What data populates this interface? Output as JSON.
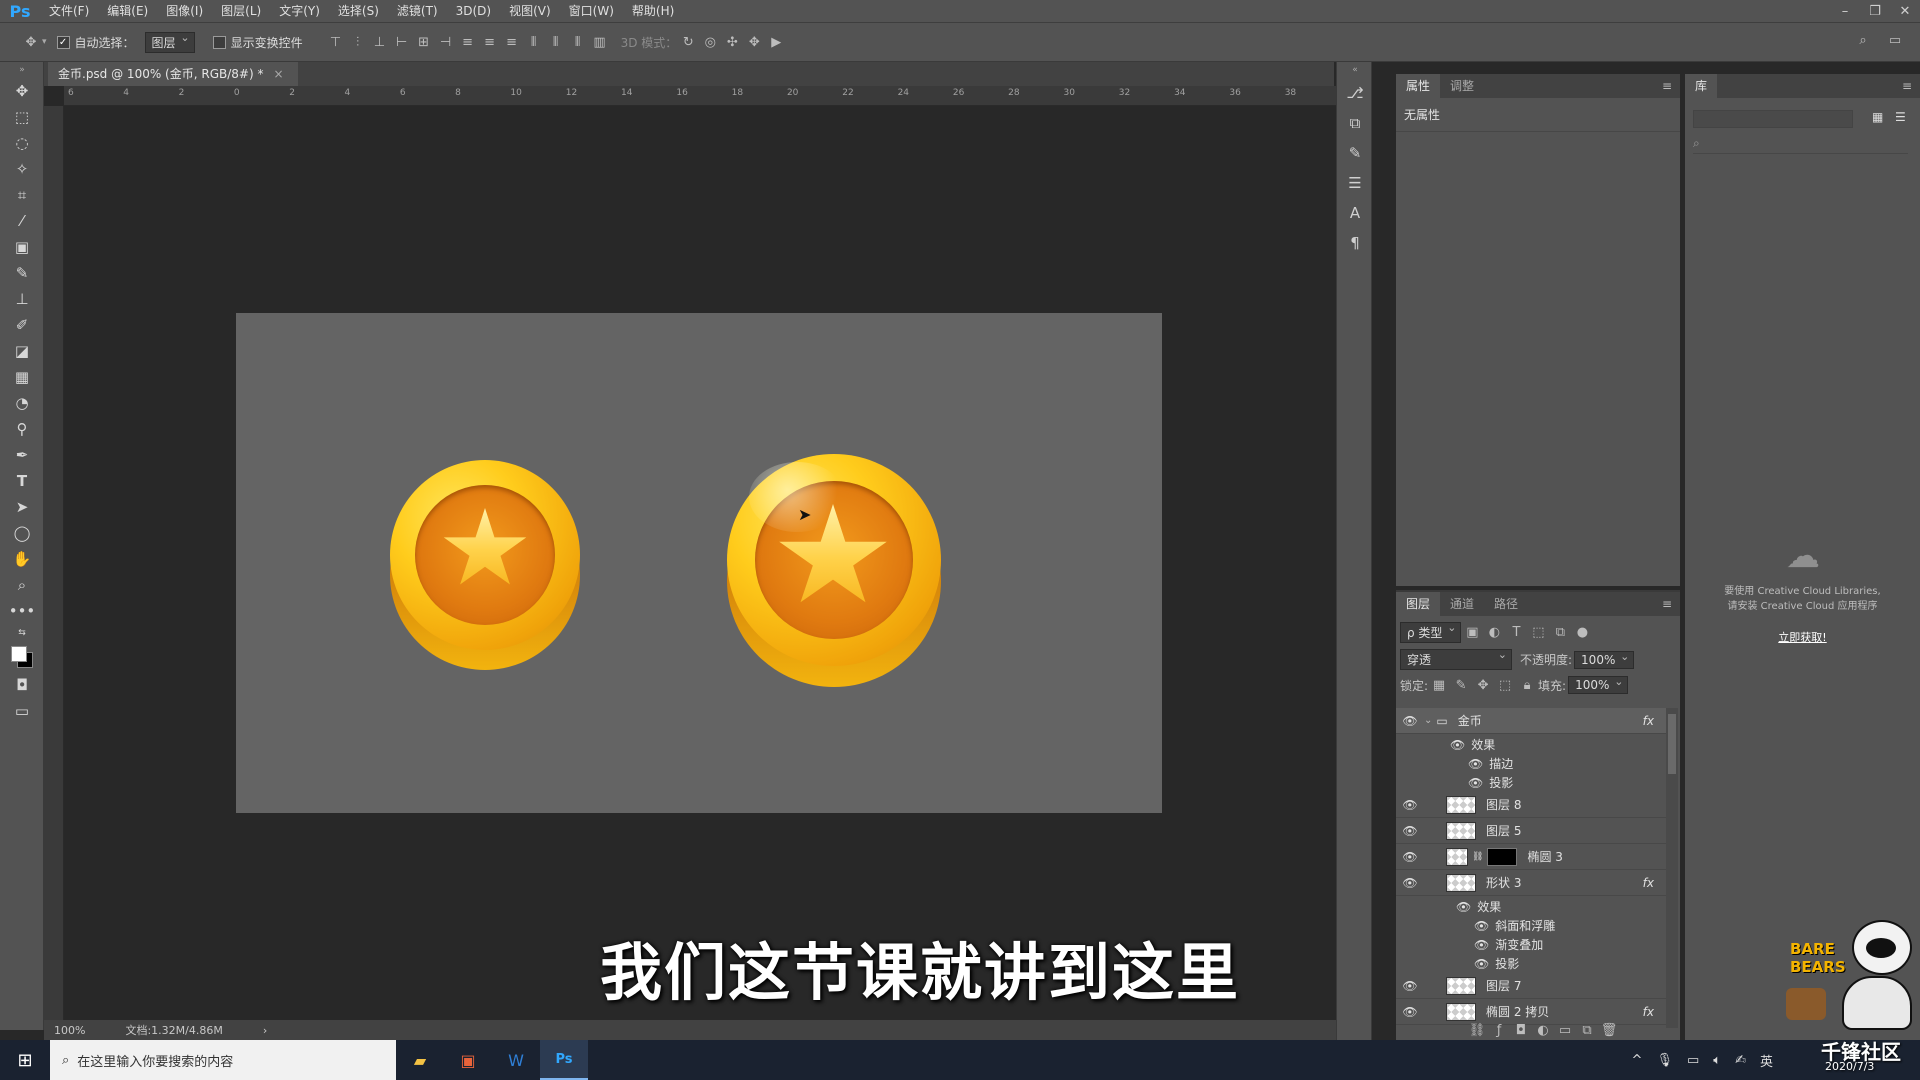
{
  "app": {
    "logo": "Ps",
    "menu": [
      "文件(F)",
      "编辑(E)",
      "图像(I)",
      "图层(L)",
      "文字(Y)",
      "选择(S)",
      "滤镜(T)",
      "3D(D)",
      "视图(V)",
      "窗口(W)",
      "帮助(H)"
    ]
  },
  "options": {
    "auto_select_label": "自动选择：",
    "auto_select_value": "图层",
    "show_transform_label": "显示变换控件",
    "mode3d_label": "3D 模式："
  },
  "document": {
    "tab_title": "金币.psd @ 100% (金币, RGB/8#) *",
    "close": "×",
    "ruler_ticks": [
      "6",
      "4",
      "2",
      "0",
      "2",
      "4",
      "6",
      "8",
      "10",
      "12",
      "14",
      "16",
      "18",
      "20",
      "22",
      "24",
      "26",
      "28",
      "30",
      "32",
      "34",
      "36",
      "38"
    ]
  },
  "status": {
    "zoom": "100%",
    "doc_info": "文档:1.32M/4.86M",
    "arrow": "›"
  },
  "subtitle": "我们这节课就讲到这里",
  "properties": {
    "tabs": [
      "属性",
      "调整"
    ],
    "content": "无属性"
  },
  "library": {
    "tab": "库",
    "message_line1": "要使用 Creative Cloud Libraries,",
    "message_line2": "请安装 Creative Cloud 应用程序",
    "link": "立即获取!"
  },
  "layers": {
    "tabs": [
      "图层",
      "通道",
      "路径"
    ],
    "filter_label": "ρ 类型",
    "blend_mode": "穿透",
    "opacity_label": "不透明度:",
    "opacity_value": "100%",
    "lock_label": "锁定:",
    "fill_label": "填充:",
    "fill_value": "100%",
    "group": "金币",
    "group_effects": "效果",
    "group_effect_items": [
      "描边",
      "投影"
    ],
    "items": [
      "图层 8",
      "图层 5",
      "椭圆 3",
      "形状 3"
    ],
    "shape3_effects": "效果",
    "shape3_effect_items": [
      "斜面和浮雕",
      "渐变叠加",
      "投影"
    ],
    "more_items": [
      "图层 7",
      "椭圆 2 拷贝"
    ],
    "fx": "fx"
  },
  "taskbar": {
    "search_placeholder": "在这里输入你要搜索的内容",
    "ime": "英",
    "watermark": "千锋社区",
    "watermark_date": "2020/7/3"
  }
}
